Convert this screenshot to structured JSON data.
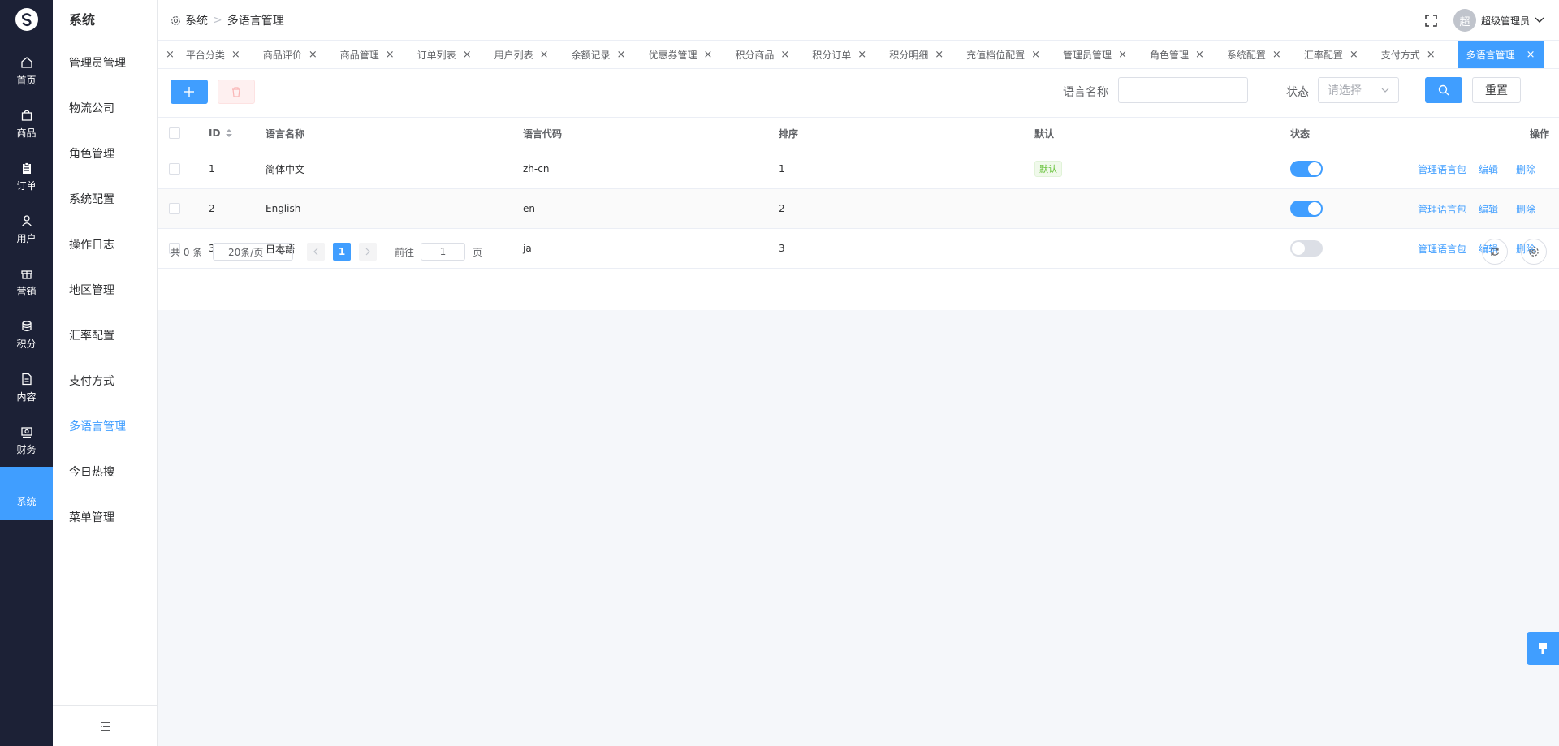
{
  "rail": {
    "items": [
      {
        "label": "首页",
        "icon": "home-icon"
      },
      {
        "label": "商品",
        "icon": "shopping-bag-icon"
      },
      {
        "label": "订单",
        "icon": "clipboard-icon"
      },
      {
        "label": "用户",
        "icon": "user-icon"
      },
      {
        "label": "营销",
        "icon": "gift-icon"
      },
      {
        "label": "积分",
        "icon": "coins-icon"
      },
      {
        "label": "内容",
        "icon": "document-icon"
      },
      {
        "label": "财务",
        "icon": "wallet-icon"
      },
      {
        "label": "系统",
        "icon": "gear-icon",
        "active": true
      }
    ]
  },
  "submenu": {
    "title": "系统",
    "items": [
      "管理员管理",
      "物流公司",
      "角色管理",
      "系统配置",
      "操作日志",
      "地区管理",
      "汇率配置",
      "支付方式",
      "多语言管理",
      "今日热搜",
      "菜单管理"
    ],
    "active": "多语言管理"
  },
  "header": {
    "crumb_root": "系统",
    "crumb_current": "多语言管理",
    "user_avatar": "超",
    "user_name": "超级管理员"
  },
  "tabs": [
    "平台分类",
    "商品评价",
    "商品管理",
    "订单列表",
    "用户列表",
    "余额记录",
    "优惠券管理",
    "积分商品",
    "积分订单",
    "积分明细",
    "充值档位配置",
    "管理员管理",
    "角色管理",
    "系统配置",
    "汇率配置",
    "支付方式",
    "多语言管理"
  ],
  "active_tab": "多语言管理",
  "filters": {
    "name_label": "语言名称",
    "name_value": "",
    "status_label": "状态",
    "status_placeholder": "请选择",
    "reset_label": "重置"
  },
  "table": {
    "headers": {
      "id": "ID",
      "name": "语言名称",
      "code": "语言代码",
      "sort": "排序",
      "default": "默认",
      "status": "状态",
      "ops": "操作"
    },
    "rows": [
      {
        "id": "1",
        "name": "简体中文",
        "code": "zh-cn",
        "sort": "1",
        "default": "默认",
        "status": true
      },
      {
        "id": "2",
        "name": "English",
        "code": "en",
        "sort": "2",
        "default": "",
        "status": true
      },
      {
        "id": "3",
        "name": "日本語",
        "code": "ja",
        "sort": "3",
        "default": "",
        "status": false
      }
    ],
    "op_labels": {
      "pack": "管理语言包",
      "edit": "编辑",
      "delete": "删除"
    }
  },
  "pager": {
    "total_text": "共 0 条",
    "page_size": "20条/页",
    "current_page": "1",
    "goto_label": "前往",
    "goto_value": "1",
    "page_unit": "页"
  },
  "colors": {
    "primary": "#409eff",
    "rail_bg": "#1c2136",
    "success": "#67c23a"
  }
}
